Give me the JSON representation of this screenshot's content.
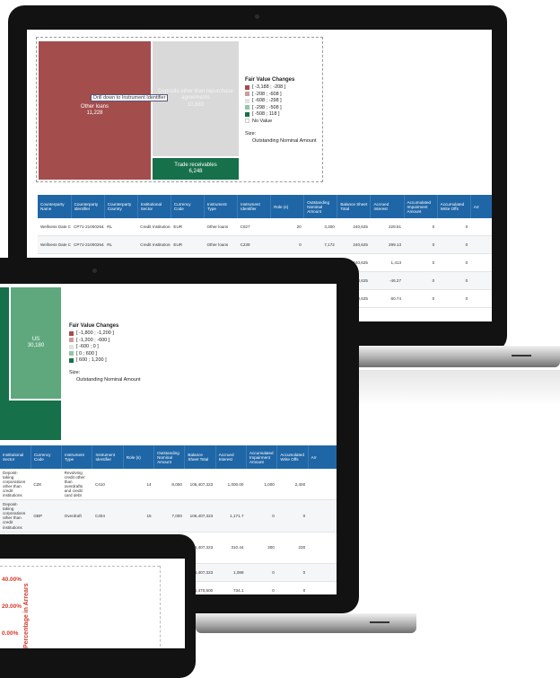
{
  "laptop": {
    "treemap": {
      "tiles": [
        {
          "label": "Other loans",
          "value": "11,228"
        },
        {
          "label": "Deposits other than repurchase agreements",
          "value": "10,883"
        },
        {
          "label": "Trade receivables",
          "value": "6,248"
        }
      ],
      "tooltip": "Drill down to Instrument Identifier"
    },
    "legend": {
      "title": "Fair Value Changes",
      "items": [
        {
          "label": "[ -3,188 ; -208 ]",
          "color": "#a44d4d"
        },
        {
          "label": "[ -208 ; -608 ]",
          "color": "#cd9d9d"
        },
        {
          "label": "[ -608 ; -298 ]",
          "color": "#e2e2e2"
        },
        {
          "label": "[ -298 ; -508 ]",
          "color": "#8fc7a7"
        },
        {
          "label": "[ -508 ; 118 ]",
          "color": "#16714a"
        },
        {
          "label": "No Value",
          "color": "#ffffff"
        }
      ],
      "size_title": "Size:",
      "size_value": "Outstanding Nominal Amount"
    },
    "table": {
      "headers": [
        "Counterparty Name",
        "Counterparty Identifier",
        "Counterparty Country",
        "Institutional Sector",
        "Currency Code",
        "Instrument Type",
        "Instrument Identifier",
        "Role (s)",
        "Outstanding Nominal Amount",
        "Balance Sheet Total",
        "Accrued Interest",
        "Accumulated Impairment Amount",
        "Accumulated Write Offs",
        "Arr"
      ],
      "rows": [
        [
          "Wellness Date Corp.",
          "CP71-210002644",
          "RL",
          "Credit Institutions",
          "EUR",
          "Other loans",
          "C027",
          "20",
          "3,300",
          "240,625",
          "229.51",
          "0",
          "0",
          ""
        ],
        [
          "Wellness Date Corp.",
          "CP71-210002644",
          "RL",
          "Credit Institutions",
          "EUR",
          "Other loans",
          "C239",
          "0",
          "7,172",
          "240,625",
          "299.13",
          "0",
          "0",
          ""
        ],
        [
          "",
          "",
          "",
          "",
          "",
          "Revolving",
          "",
          "",
          "000",
          "240,625",
          "1,413",
          "0",
          "0",
          ""
        ],
        [
          "",
          "",
          "",
          "",
          "",
          "",
          "",
          "",
          "",
          "240,625",
          "-46.27",
          "0",
          "0",
          ""
        ],
        [
          "",
          "",
          "",
          "",
          "",
          "",
          "",
          "",
          "",
          "240,625",
          "60.74",
          "0",
          "0",
          ""
        ]
      ]
    }
  },
  "tablet": {
    "treemap": {
      "tiles": [
        {
          "label": "",
          "value": ""
        },
        {
          "label": "US",
          "value": "30,180"
        },
        {
          "label": "",
          "value": ""
        }
      ]
    },
    "legend": {
      "title": "Fair Value Changes",
      "items": [
        {
          "label": "[ -1,800 ; -1,200 ]",
          "color": "#a44d4d"
        },
        {
          "label": "[ -1,200 ; -600 ]",
          "color": "#cd9d9d"
        },
        {
          "label": "[ -600 ; 0 ]",
          "color": "#e2e2e2"
        },
        {
          "label": "[ 0 ; 600 ]",
          "color": "#8fc7a7"
        },
        {
          "label": "[ 600 ; 1,200 ]",
          "color": "#16714a"
        }
      ],
      "size_title": "Size:",
      "size_value": "Outstanding Nominal Amount"
    },
    "table": {
      "headers": [
        "Institutional Sector",
        "Currency Code",
        "Instrument Type",
        "Instrument Identifier",
        "Role (s)",
        "Outstanding Nominal Amount",
        "Balance Sheet Total",
        "Accrued Interest",
        "Accumulated Impairment Amount",
        "Accumulated Write Offs",
        "Arr"
      ],
      "rows": [
        [
          "Deposit-taking corporations other than credit institutions",
          "CZK",
          "Revolving credit other than overdrafts and credit card debt",
          "C410",
          "14",
          "8,000",
          "106,407,323",
          "1,000.00",
          "1,000",
          "2,400",
          ""
        ],
        [
          "Deposit-taking corporations other than credit institutions",
          "GBP",
          "Overdraft",
          "C404",
          "15",
          "7,000",
          "106,407,323",
          "1,171.7",
          "0",
          "0",
          ""
        ],
        [
          "Deposit-taking corporations other than credit institutions",
          "GBP",
          "Overdraft",
          "C427",
          "18",
          "1,000",
          "106,407,323",
          "310.44",
          "300",
          "230",
          ""
        ],
        [
          "",
          "",
          "",
          "",
          "",
          "20,150",
          "106,407,323",
          "1,088",
          "0",
          "0",
          ""
        ],
        [
          "",
          "",
          "",
          "",
          "",
          "",
          "5,470,500",
          "734.1",
          "0",
          "0",
          ""
        ],
        [
          "",
          "",
          "",
          "",
          "",
          "",
          "3,370,000",
          "2,187.40",
          "",
          "",
          ""
        ]
      ]
    }
  },
  "phone": {
    "percent_labels": [
      "40.00%",
      "20.00%",
      "0.00%"
    ],
    "axis_label": "Percentage in Arrears"
  }
}
